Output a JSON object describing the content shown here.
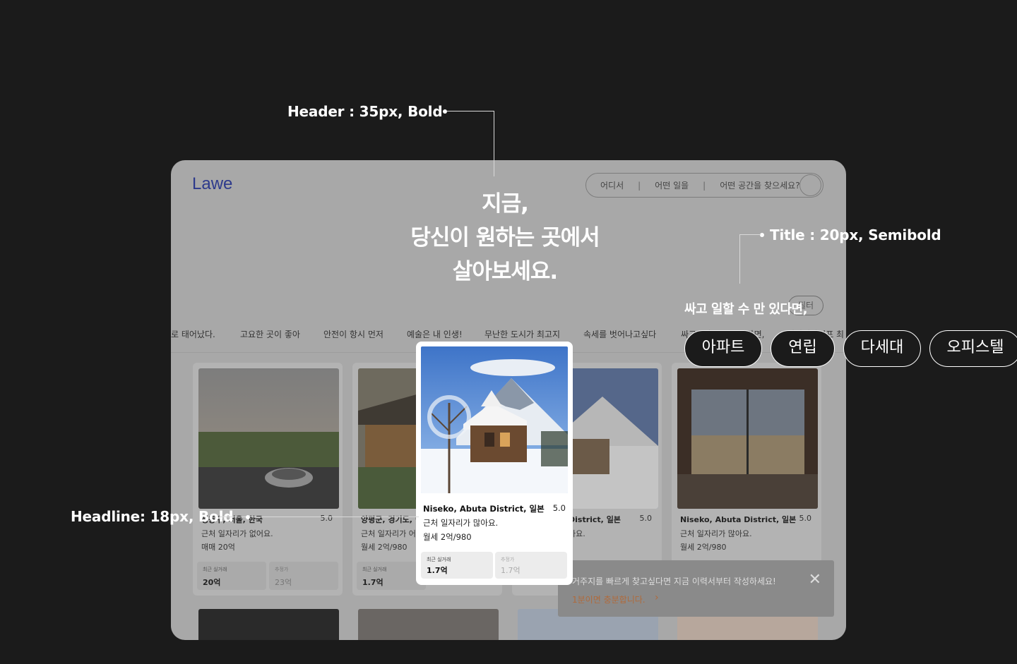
{
  "annotations": {
    "header": "Header : 35px, Bold",
    "title": "Title : 20px, Semibold",
    "headline": "Headline: 18px, Bold"
  },
  "app": {
    "logo": "Lawe",
    "search": {
      "where": "어디서",
      "what": "어떤 일을",
      "space": "어떤 공간을 찾으세요?"
    },
    "hero": {
      "line1": "지금,",
      "line2": "당신이 원하는 곳에서",
      "line3": "살아보세요."
    },
    "filter_label": "필터",
    "categories": [
      "로 태어났다.",
      "고요한 곳이 좋아",
      "안전이 항시 먼저",
      "예술은 내 인생!",
      "무난한 도시가 최고지",
      "속세를 벗어나고싶다",
      "싸고 일할 수 만 있다면,",
      "미니멀라이프 최"
    ],
    "cards": [
      {
        "location": "성동구, 서울, 한국",
        "rating": "5.0",
        "desc": "근처 일자리가 없어요.",
        "price": "매매 20억",
        "stat1_label": "최근 실거래",
        "stat1_value": "20억",
        "stat2_label": "추정가",
        "stat2_value": "23억"
      },
      {
        "location": "양평군, 경기도, 한",
        "rating": "",
        "desc": "근처 일자리가 어",
        "price": "월세 2억/980",
        "stat1_label": "최근 실거래",
        "stat1_value": "1.7억",
        "stat2_label": "",
        "stat2_value": ""
      },
      {
        "location": "District, 일본",
        "rating": "5.0",
        "desc": "아요.",
        "price": "",
        "stat1_label": "",
        "stat1_value": "",
        "stat2_label": "",
        "stat2_value": ""
      },
      {
        "location": "Niseko, Abuta District, 일본",
        "rating": "5.0",
        "desc": "근처 일자리가 많아요.",
        "price": "월세 2억/980",
        "stat1_label": "",
        "stat1_value": "",
        "stat2_label": "",
        "stat2_value": ""
      }
    ],
    "toast": {
      "message": "거주지를 빠르게 찾고싶다면 지금 이력서부터 작성하세요!",
      "cta": "1분이면 충분합니다."
    }
  },
  "focus_card": {
    "location": "Niseko, Abuta District, 일본",
    "rating": "5.0",
    "desc": "근처 일자리가 많아요.",
    "price": "월세 2억/980",
    "stat1_label": "최근 실거래",
    "stat1_value": "1.7억",
    "stat2_label": "추정가",
    "stat2_value": "1.7억"
  },
  "title_sample": "싸고 일할 수 만 있다면,",
  "chips": [
    "아파트",
    "연립",
    "다세대",
    "오피스텔"
  ],
  "colors": {
    "background": "#1b1b1b",
    "logo": "#2d3a8c",
    "cta": "#b06a3b"
  }
}
